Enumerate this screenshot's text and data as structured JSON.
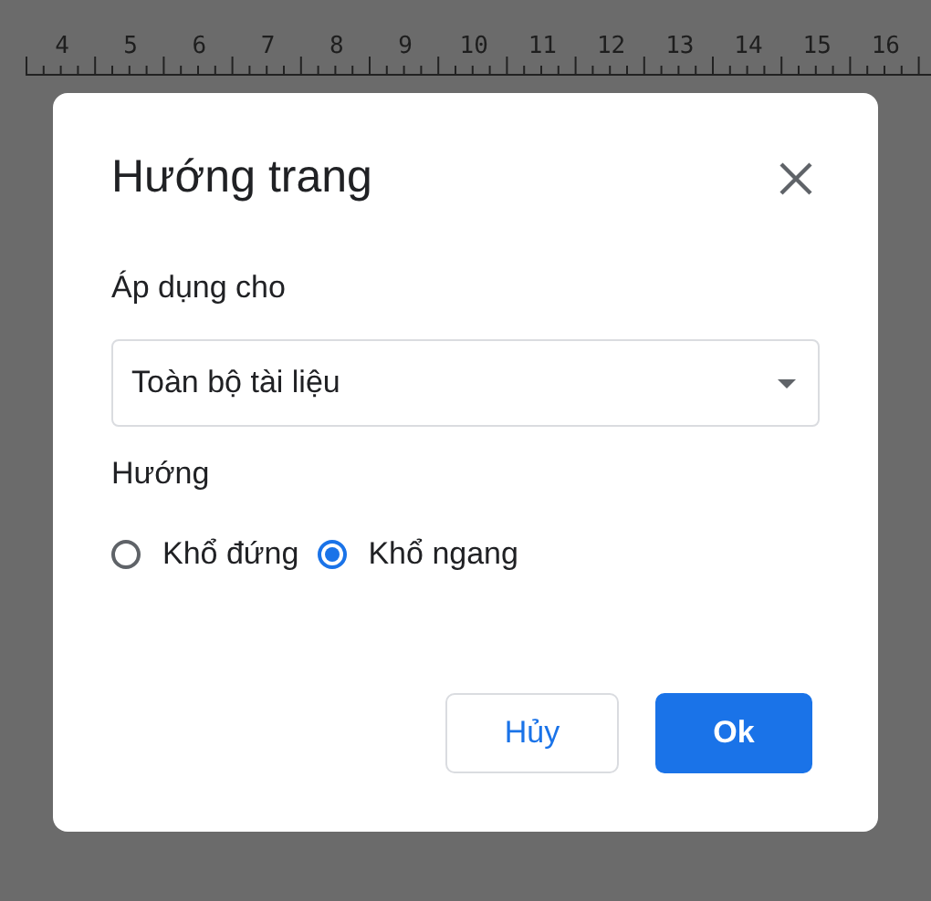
{
  "ruler": {
    "numbers": [
      "4",
      "5",
      "6",
      "7",
      "8",
      "9",
      "10",
      "11",
      "12",
      "13",
      "14",
      "15",
      "16"
    ]
  },
  "dialog": {
    "title": "Hướng trang",
    "apply_label": "Áp dụng cho",
    "apply_value": "Toàn bộ tài liệu",
    "orientation_label": "Hướng",
    "options": [
      {
        "label": "Khổ đứng",
        "selected": false
      },
      {
        "label": "Khổ ngang",
        "selected": true
      }
    ],
    "buttons": [
      {
        "label": "Hủy",
        "kind": "secondary"
      },
      {
        "label": "Ok",
        "kind": "primary"
      }
    ]
  }
}
